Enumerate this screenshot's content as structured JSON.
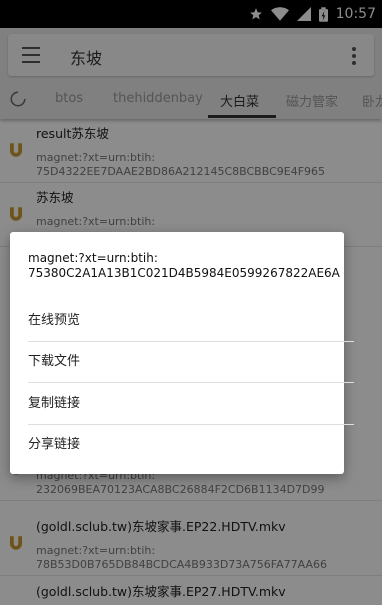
{
  "status_bar": {
    "time": "10:57",
    "icons": [
      "star-icon",
      "wifi-icon",
      "signal-icon",
      "battery-icon"
    ]
  },
  "search": {
    "query": "东坡",
    "menu_icon": "hamburger-icon",
    "more_icon": "more-vert-icon"
  },
  "tabs": {
    "items": [
      "btos",
      "thehiddenbay",
      "大白菜",
      "磁力管家",
      "卧龙"
    ],
    "active": "大白菜",
    "refresh_icon": "refresh-icon"
  },
  "list": [
    {
      "title": "result苏东坡",
      "magnet_prefix": "magnet:?xt=urn:btih:",
      "hash": "75D4322EE7DAAE2BD86A212145C8BCBBC9E4F965"
    },
    {
      "title": "苏东坡",
      "magnet_prefix": "magnet:?xt=urn:btih:",
      "hash": ""
    },
    {
      "title": "",
      "magnet_prefix": "magnet:?xt=urn:btih:",
      "hash": "232069BEA70123ACA8BC26884F2CD6B1134D7D99"
    },
    {
      "title": "(goldl.sclub.tw)东坡家事.EP22.HDTV.mkv",
      "magnet_prefix": "magnet:?xt=urn:btih:",
      "hash": "78B53D0B765DB84BCDCA4B933D73A756FA77AA66"
    },
    {
      "title": "(goldl.sclub.tw)东坡家事.EP27.HDTV.mkv",
      "magnet_prefix": "",
      "hash": ""
    }
  ],
  "dialog": {
    "magnet_prefix": "magnet:?xt=urn:btih:",
    "hash": "75380C2A1A13B1C021D4B5984E0599267822AE6A",
    "options": [
      "在线预览",
      "下载文件",
      "复制链接",
      "分享链接"
    ]
  },
  "colors": {
    "magnet_icon": "#c99a2e",
    "statusbar": "#000000",
    "toolbar": "#e9e9e9"
  }
}
